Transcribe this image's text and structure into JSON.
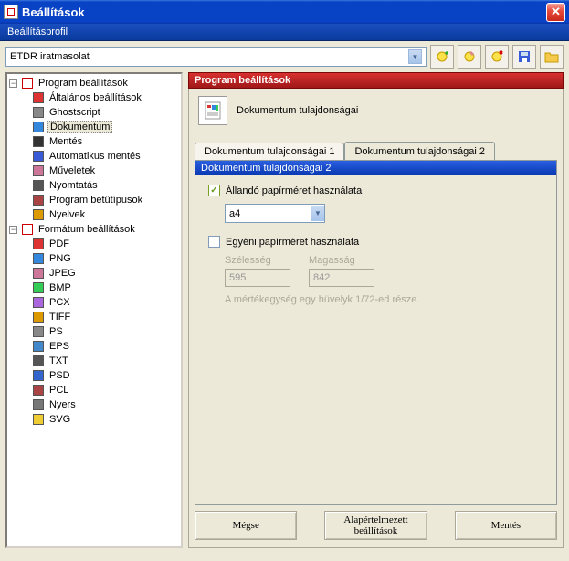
{
  "window": {
    "title": "Beállítások"
  },
  "subheader": "Beállításprofil",
  "profile": {
    "value": "ETDR iratmasolat"
  },
  "toolbar_icons": [
    "add-profile",
    "edit-profile",
    "delete-profile",
    "save-profile",
    "open-folder"
  ],
  "tree": {
    "program": {
      "label": "Program beállítások",
      "children": [
        {
          "label": "Általános beállítások",
          "icon": "general"
        },
        {
          "label": "Ghostscript",
          "icon": "ghost"
        },
        {
          "label": "Dokumentum",
          "icon": "doc",
          "selected": true
        },
        {
          "label": "Mentés",
          "icon": "save"
        },
        {
          "label": "Automatikus mentés",
          "icon": "autosave"
        },
        {
          "label": "Műveletek",
          "icon": "actions"
        },
        {
          "label": "Nyomtatás",
          "icon": "print"
        },
        {
          "label": "Program betűtípusok",
          "icon": "font"
        },
        {
          "label": "Nyelvek",
          "icon": "lang"
        }
      ]
    },
    "format": {
      "label": "Formátum beállítások",
      "children": [
        {
          "label": "PDF",
          "icon": "pdf"
        },
        {
          "label": "PNG",
          "icon": "png"
        },
        {
          "label": "JPEG",
          "icon": "jpeg"
        },
        {
          "label": "BMP",
          "icon": "bmp"
        },
        {
          "label": "PCX",
          "icon": "pcx"
        },
        {
          "label": "TIFF",
          "icon": "tiff"
        },
        {
          "label": "PS",
          "icon": "ps"
        },
        {
          "label": "EPS",
          "icon": "eps"
        },
        {
          "label": "TXT",
          "icon": "txt"
        },
        {
          "label": "PSD",
          "icon": "psd"
        },
        {
          "label": "PCL",
          "icon": "pcl"
        },
        {
          "label": "Nyers",
          "icon": "raw"
        },
        {
          "label": "SVG",
          "icon": "svg"
        }
      ]
    }
  },
  "right": {
    "header": "Program beállítások",
    "desc": "Dokumentum tulajdonságai",
    "tabs": [
      {
        "label": "Dokumentum tulajdonságai 1",
        "active": false
      },
      {
        "label": "Dokumentum tulajdonságai 2",
        "active": true
      }
    ],
    "section_title": "Dokumentum tulajdonságai 2",
    "fixed_paper": {
      "label": "Állandó papírméret használata",
      "checked": true,
      "value": "a4"
    },
    "custom_paper": {
      "label": "Egyéni papírméret használata",
      "checked": false
    },
    "width_label": "Szélesség",
    "height_label": "Magasság",
    "width_value": "595",
    "height_value": "842",
    "hint": "A mértékegység egy hüvelyk 1/72-ed része."
  },
  "buttons": {
    "cancel": "Mégse",
    "defaults": "Alapértelmezett beállítások",
    "save": "Mentés"
  },
  "colors": {
    "titlebar": "#0842c5",
    "group_red": "#c02020",
    "section_blue": "#1040c0"
  }
}
